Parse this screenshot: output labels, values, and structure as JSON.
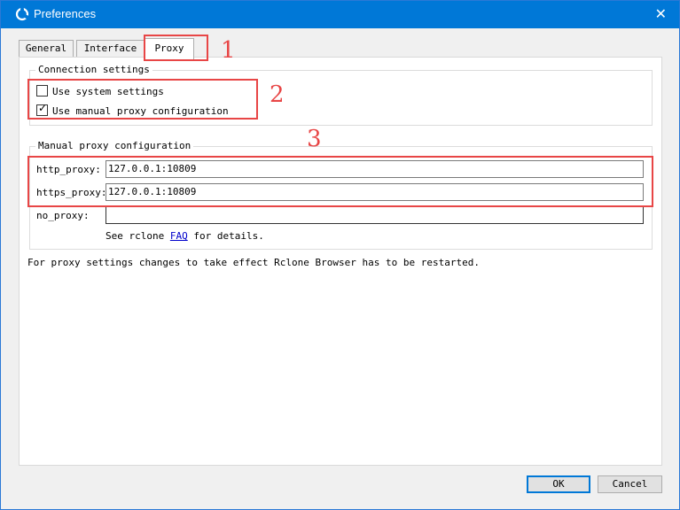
{
  "window": {
    "title": "Preferences",
    "close_glyph": "✕",
    "app_icon": "rclone-icon"
  },
  "tabs": [
    {
      "label": "General",
      "active": false
    },
    {
      "label": "Interface",
      "active": false
    },
    {
      "label": "Proxy",
      "active": true
    }
  ],
  "connection": {
    "title": "Connection settings",
    "use_system": {
      "label": "Use system settings",
      "checked": false
    },
    "use_manual": {
      "label": "Use manual proxy configuration",
      "checked": true,
      "check_glyph": "✓"
    }
  },
  "manual": {
    "title": "Manual proxy configuration",
    "http_label": "http_proxy:",
    "http_value": "127.0.0.1:10809",
    "https_label": "https_proxy:",
    "https_value": "127.0.0.1:10809",
    "no_proxy_label": "no_proxy:",
    "no_proxy_value": "",
    "see_pre": "See rclone",
    "faq_link": "FAQ",
    "see_post": "for details."
  },
  "note": "For proxy settings changes to take effect Rclone Browser has to be restarted.",
  "buttons": {
    "ok": "OK",
    "cancel": "Cancel"
  },
  "annotations": [
    "1",
    "2",
    "3"
  ],
  "colors": {
    "titlebar": "#0078d7",
    "annotation": "#e84646",
    "link": "#0000cc"
  }
}
